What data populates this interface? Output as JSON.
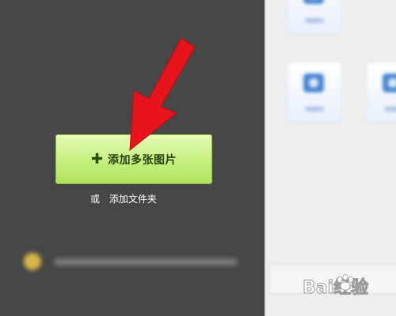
{
  "upload_panel": {
    "add_images_label": "添加多张图片",
    "or_text": "或",
    "add_folder_label": "添加文件夹"
  },
  "icons": {
    "plus": "plus-icon",
    "arrow": "red-arrow-icon",
    "watermark": "baidu-jingyan-watermark"
  },
  "watermark": {
    "text": "Bai经验"
  },
  "colors": {
    "panel_background": "#464646",
    "button_gradient_top": "#e6fbb6",
    "button_gradient_bottom": "#afe35c",
    "arrow": "#e8141b"
  }
}
